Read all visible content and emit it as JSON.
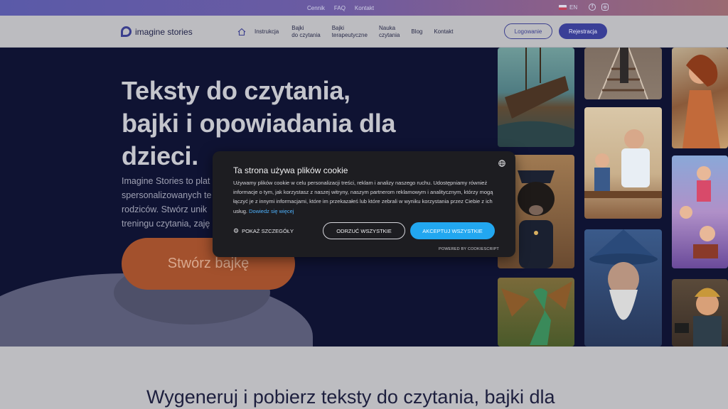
{
  "topbar": {
    "links": [
      "Cennik",
      "FAQ",
      "Kontakt"
    ],
    "language": "EN"
  },
  "nav": {
    "logo_text": "imagine stories",
    "items": [
      {
        "label": "Instrukcja"
      },
      {
        "label": "Bajki",
        "label2": "do czytania"
      },
      {
        "label": "Bajki",
        "label2": "terapeutyczne"
      },
      {
        "label": "Nauka",
        "label2": "czytania"
      },
      {
        "label": "Blog"
      },
      {
        "label": "Kontakt"
      }
    ],
    "login_label": "Logowanie",
    "register_label": "Rejestracja"
  },
  "hero": {
    "title_line1": "Teksty do czytania,",
    "title_line2": "bajki i opowiadania dla",
    "title_line3": "dzieci.",
    "text_line1": "Imagine Stories to plat",
    "text_line2": "spersonalizowanych te",
    "text_line3": "rodziców. Stwórz unik",
    "text_line4": "treningu czytania, zaję",
    "cta_label": "Stwórz bajkę"
  },
  "bottom": {
    "title": "Wygeneruj i pobierz teksty do czytania, bajki dla"
  },
  "cookie": {
    "title": "Ta strona używa plików cookie",
    "body": "Używamy plików cookie w celu personalizacji treści, reklam i analizy naszego ruchu. Udostępniamy również informacje o tym, jak korzystasz z naszej witryny, naszym partnerom reklamowym i analitycznym, którzy mogą łączyć je z innymi informacjami, które im przekazałeś lub które zebrali w wyniku korzystania przez Ciebie z ich usług.",
    "link_text": "Dowiedz się więcej",
    "details_label": "POKAŻ SZCZEGÓŁY",
    "reject_label": "ODRZUĆ WSZYSTKIE",
    "accept_label": "AKCEPTUJ WSZYSTKIE",
    "powered_by": "POWERED BY COOKIESCRIPT"
  }
}
